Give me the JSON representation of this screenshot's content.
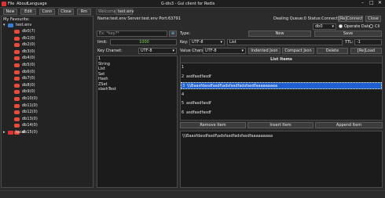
{
  "window": {
    "title": "G-dis3 - Gui client for Redis",
    "menu": [
      "File",
      "About",
      "Language"
    ]
  },
  "toolbar": [
    "New",
    "Edit",
    "Conn",
    "Close",
    "Rm"
  ],
  "sidebar": {
    "label": "My Favourite:",
    "connection": "test.env",
    "dbs": [
      "db0(7)",
      "db1(0)",
      "db2(0)",
      "db3(0)",
      "db4(0)",
      "db5(0)",
      "db6(0)",
      "db7(0)",
      "db8(0)",
      "db9(0)",
      "db10(0)",
      "db11(0)",
      "db12(0)",
      "db13(0)",
      "db14(0)",
      "db15(0)"
    ],
    "local": "local"
  },
  "tabs": [
    "Welcome",
    "test.env"
  ],
  "header": {
    "info": "Name:test.env Server:test.env Port:63791",
    "status": "Dealing Queue:0 Status:Connected",
    "reconnect": "[Re]Connect",
    "close": "Close",
    "db_select": "db0",
    "operate_label": "Operate Data",
    "cli_label": "Cli"
  },
  "left_panel": {
    "search_placeholder": "Ex: *key?*",
    "search_btn": "⊕",
    "limit_label": "limit:",
    "limit_value": "1000",
    "key_charset_label": "Key Charset:",
    "key_charset_value": "UTF-8",
    "keys": [
      "1",
      "String",
      "List",
      "Set",
      "Hash",
      "ZSet",
      "slashTest"
    ]
  },
  "right_panel": {
    "type_label": "Type:",
    "new_btn": "New",
    "save_btn": "Save",
    "key_label": "Key:",
    "key_charset": "UTF-8",
    "key_value": "List",
    "ttl_label": "TTL:",
    "ttl_value": "-1",
    "value_charset_label": "Value Charset:",
    "value_charset": "UTF-8",
    "indented_json": "Indented Json",
    "compact_json": "Compact Json",
    "delete": "Delete",
    "reload": "[Re]Load",
    "list_header": "List Items",
    "items": [
      {
        "idx": "1",
        "val": ""
      },
      {
        "idx": "2",
        "val": "asdfasdfasdf"
      },
      {
        "idx": "3",
        "val": "\\\\\\Baasfdasdfasdf\\adsfasdfadsfasdfaaaaaaaaa"
      },
      {
        "idx": "4",
        "val": ""
      },
      {
        "idx": "5",
        "val": "asdfasdfasdf"
      },
      {
        "idx": "6",
        "val": "asdfasdfasdf"
      }
    ],
    "selected_index": 2,
    "remove_item": "Remove Item",
    "insert_item": "Insert Item",
    "append_item": "Append Item",
    "detail_value": "\\\\\\Baasfdasdfasdf\\adsfasdfadsfasdfaaaaaaaaa"
  },
  "colors": {
    "accent": "#1f5fd1",
    "db_icon": "#e84b3c",
    "limit": "#7ed957"
  }
}
